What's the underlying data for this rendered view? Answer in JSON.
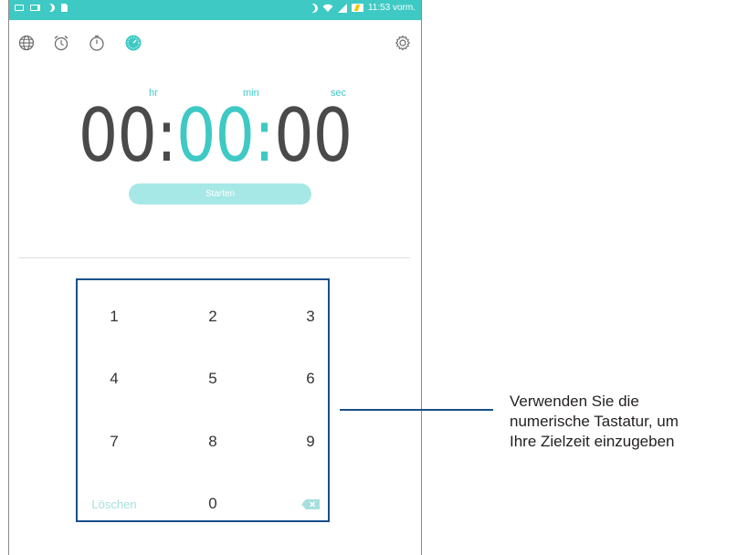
{
  "statusbar": {
    "time": "11:53 vorm.",
    "icons_left": [
      "notification-icon",
      "cast-icon",
      "moon-icon",
      "sd-card-icon"
    ],
    "icons_right": [
      "do-not-disturb-icon",
      "wifi-icon",
      "signal-icon",
      "battery-charging-icon"
    ]
  },
  "tabs": [
    {
      "name": "world-clock",
      "icon": "globe-icon"
    },
    {
      "name": "alarm",
      "icon": "alarm-clock-icon"
    },
    {
      "name": "stopwatch",
      "icon": "stopwatch-icon"
    },
    {
      "name": "timer",
      "icon": "timer-icon",
      "active": true
    }
  ],
  "settings_icon": "gear-icon",
  "timer": {
    "hr_label": "hr",
    "min_label": "min",
    "sec_label": "sec",
    "hours": "00",
    "minutes": "00",
    "seconds": "00",
    "sep1": ":",
    "sep2": ":"
  },
  "start_button": {
    "label": "Starten"
  },
  "keypad": {
    "keys": [
      "1",
      "2",
      "3",
      "4",
      "5",
      "6",
      "7",
      "8",
      "9"
    ],
    "clear_label": "Löschen",
    "zero": "0",
    "delete_icon": "backspace-icon"
  },
  "annotation": {
    "line1": "Verwenden Sie die",
    "line2": "numerische Tastatur, um",
    "line3": "Ihre Zielzeit einzugeben"
  },
  "colors": {
    "accent": "#3ec9c4",
    "start_button_bg": "#a6e8e6",
    "callout": "#1a4f8a",
    "digits": "#4a4a4a"
  }
}
